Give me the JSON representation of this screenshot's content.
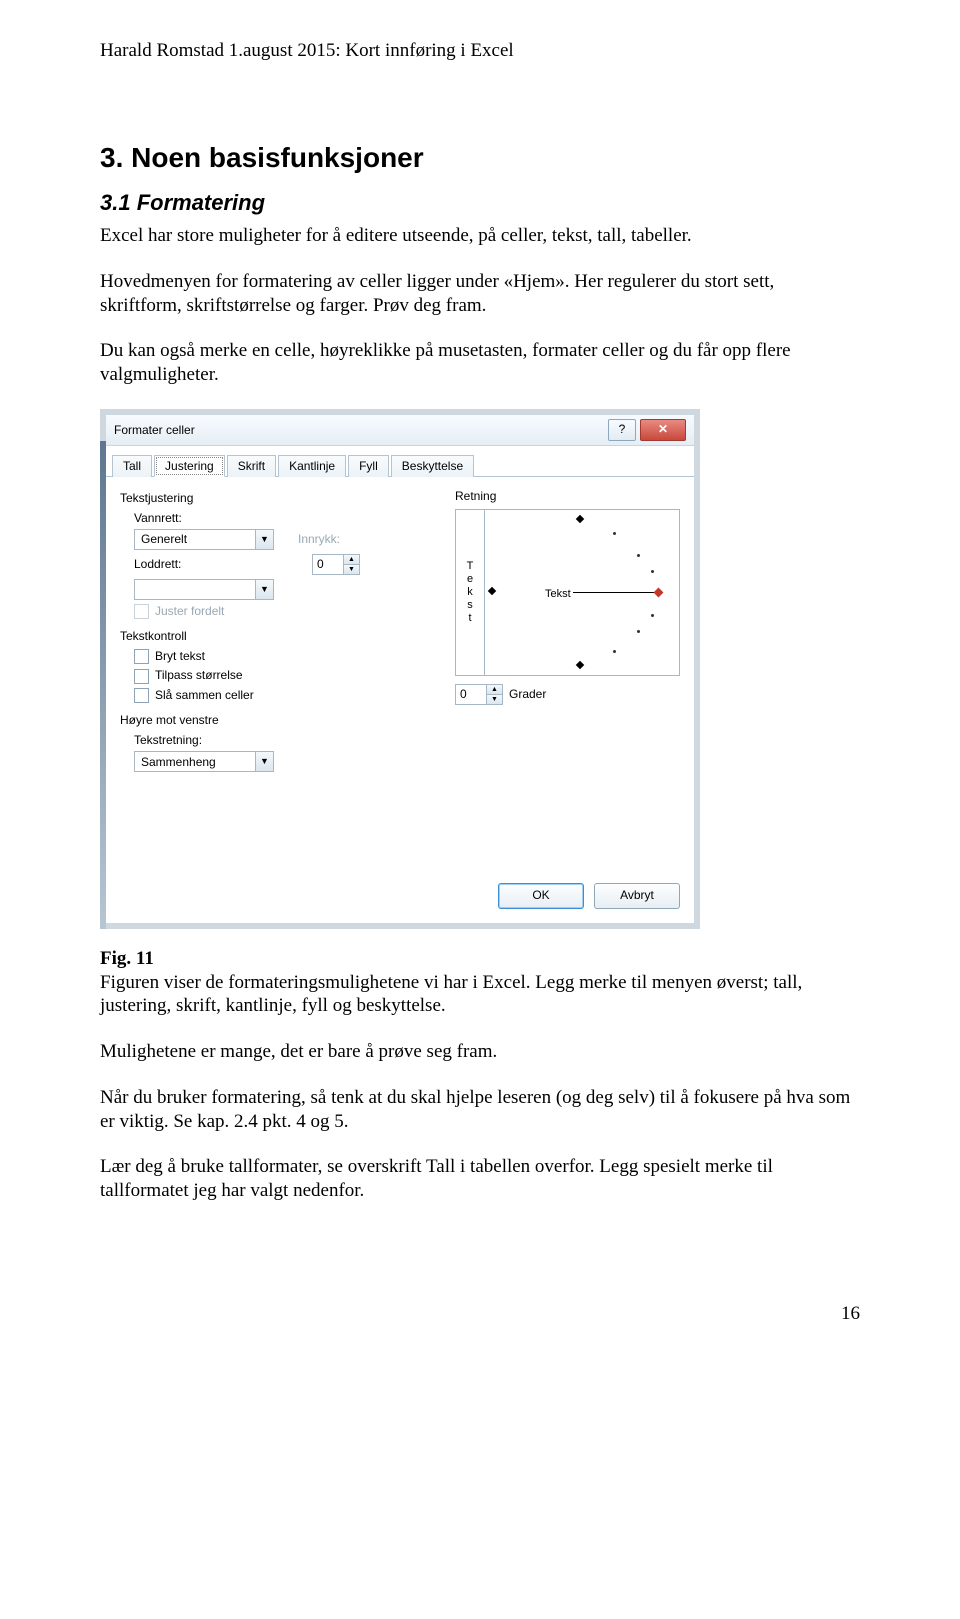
{
  "header": "Harald Romstad 1.august  2015: Kort innføring i Excel",
  "h2": "3. Noen basisfunksjoner",
  "h3": "3.1 Formatering",
  "p1": "Excel har store muligheter for å editere utseende, på celler, tekst, tall, tabeller.",
  "p2": "Hovedmenyen for formatering av celler ligger under «Hjem». Her regulerer du stort sett, skriftform, skriftstørrelse og farger. Prøv deg fram.",
  "p3": "Du kan også merke en celle, høyreklikke på musetasten, formater celler og du får opp flere valgmuligheter.",
  "caption_lead": "Fig. 11",
  "caption_rest": "Figuren viser de formateringsmulighetene vi har i Excel. Legg merke til menyen øverst; tall, justering, skrift, kantlinje, fyll og beskyttelse.",
  "p5": "Mulighetene er mange, det er bare å prøve seg fram.",
  "p6": "Når du bruker formatering, så tenk at du skal hjelpe leseren (og deg selv) til å fokusere på hva som er viktig. Se kap. 2.4 pkt. 4 og 5.",
  "p7": "Lær deg å bruke tallformater, se overskrift Tall i tabellen overfor. Legg spesielt merke til tallformatet jeg har valgt nedenfor.",
  "page_num": "16",
  "dialog": {
    "title": "Formater celler",
    "help_glyph": "?",
    "close_glyph": "✕",
    "tabs": [
      "Tall",
      "Justering",
      "Skrift",
      "Kantlinje",
      "Fyll",
      "Beskyttelse"
    ],
    "active_tab": 1,
    "sections": {
      "tekstjustering": "Tekstjustering",
      "vannrett": "Vannrett:",
      "vannrett_val": "Generelt",
      "innrykk": "Innrykk:",
      "innrykk_val": "0",
      "loddrett": "Loddrett:",
      "loddrett_val": "",
      "juster_fordelt": "Juster fordelt",
      "tekstkontroll": "Tekstkontroll",
      "bryt": "Bryt tekst",
      "tilpass": "Tilpass størrelse",
      "slaa": "Slå sammen celler",
      "hoyre_mot_venstre": "Høyre mot venstre",
      "tekstretning": "Tekstretning:",
      "tekstretning_val": "Sammenheng",
      "retning": "Retning",
      "tekst_v": "Tekst",
      "tekst_h": "Tekst",
      "grader_val": "0",
      "grader_label": "Grader"
    },
    "ok": "OK",
    "cancel": "Avbryt"
  }
}
